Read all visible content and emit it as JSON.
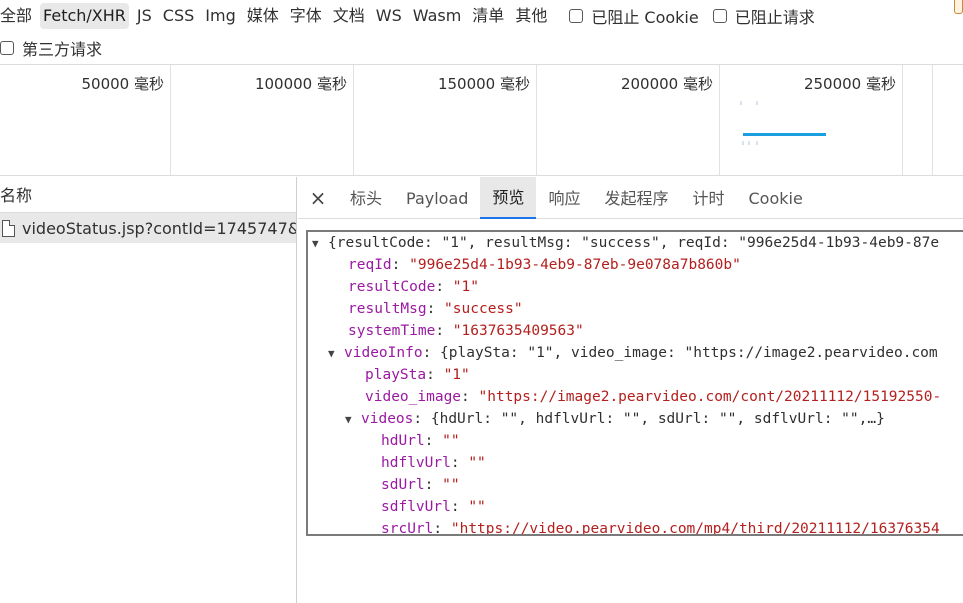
{
  "filters": {
    "row1": [
      "全部",
      "Fetch/XHR",
      "JS",
      "CSS",
      "Img",
      "媒体",
      "字体",
      "文档",
      "WS",
      "Wasm",
      "清单",
      "其他"
    ],
    "active_index": 1,
    "checkbox_blocked_cookie": "已阻止 Cookie",
    "checkbox_blocked_requests": "已阻止请求",
    "checkbox_third_party": "第三方请求"
  },
  "overview": {
    "ticks": [
      "50000 毫秒",
      "100000 毫秒",
      "150000 毫秒",
      "200000 毫秒",
      "250000 毫秒"
    ]
  },
  "request_list": {
    "header": "名称",
    "rows": [
      {
        "name": "videoStatus.jsp?contId=1745747&..."
      }
    ]
  },
  "detail": {
    "close_symbol": "×",
    "tabs": [
      "标头",
      "Payload",
      "预览",
      "响应",
      "发起程序",
      "计时",
      "Cookie"
    ],
    "active_tab_index": 2
  },
  "preview": {
    "root_summary": "{resultCode: \"1\", resultMsg: \"success\", reqId: \"996e25d4-1b93-4eb9-87e",
    "reqId_key": "reqId",
    "reqId_val": "\"996e25d4-1b93-4eb9-87eb-9e078a7b860b\"",
    "resultCode_key": "resultCode",
    "resultCode_val": "\"1\"",
    "resultMsg_key": "resultMsg",
    "resultMsg_val": "\"success\"",
    "systemTime_key": "systemTime",
    "systemTime_val": "\"1637635409563\"",
    "videoInfo_key": "videoInfo",
    "videoInfo_summary": "{playSta: \"1\", video_image: \"https://image2.pearvideo.com",
    "playSta_key": "playSta",
    "playSta_val": "\"1\"",
    "video_image_key": "video_image",
    "video_image_val": "\"https://image2.pearvideo.com/cont/20211112/15192550-",
    "videos_key": "videos",
    "videos_summary": "{hdUrl: \"\", hdflvUrl: \"\", sdUrl: \"\", sdflvUrl: \"\",…}",
    "hdUrl_key": "hdUrl",
    "hdUrl_val": "\"\"",
    "hdflvUrl_key": "hdflvUrl",
    "hdflvUrl_val": "\"\"",
    "sdUrl_key": "sdUrl",
    "sdUrl_val": "\"\"",
    "sdflvUrl_key": "sdflvUrl",
    "sdflvUrl_val": "\"\"",
    "srcUrl_key": "srcUrl",
    "srcUrl_val": "\"https://video.pearvideo.com/mp4/third/20211112/16376354"
  },
  "colors": {
    "key": "#9a1aa2",
    "string": "#b3201e",
    "accent": "#1a73e8",
    "overview_bar": "#1a9fe0"
  }
}
